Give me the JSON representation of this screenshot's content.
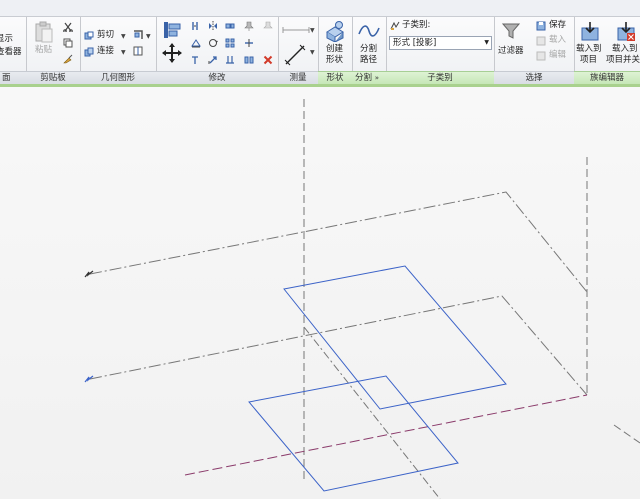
{
  "ribbon": {
    "first_panel": {
      "button_label_1": "显示",
      "button_label_2": "查看器",
      "title": "面"
    },
    "clipboard": {
      "title": "剪贴板",
      "paste_label": "粘贴"
    },
    "geometry": {
      "title": "几何图形",
      "cut_label": "剪切",
      "join_label": "连接"
    },
    "modify": {
      "title": "修改"
    },
    "measure": {
      "title": "测量"
    },
    "form": {
      "title": "形状",
      "create_label_1": "创建",
      "create_label_2": "形状"
    },
    "split": {
      "title": "分割",
      "path_label_1": "分割",
      "path_label_2": "路径"
    },
    "subcategory": {
      "title": "子类别",
      "label": "子类别:",
      "value": "形式 [投影]"
    },
    "select": {
      "title": "选择",
      "filter_label": "过滤器",
      "save_label": "保存",
      "load_label": "载入",
      "edit_label": "编辑"
    },
    "family_editor": {
      "title": "族编辑器",
      "load_project_1": "载入到",
      "load_project_2": "项目",
      "load_close_1": "载入到",
      "load_close_2": "项目并关"
    }
  },
  "colors": {
    "ribbon_accent": "#a9d18e",
    "sketch_blue": "#3c63c8",
    "reference_line": "#777777",
    "work_plane_line": "#8a3a6a"
  }
}
